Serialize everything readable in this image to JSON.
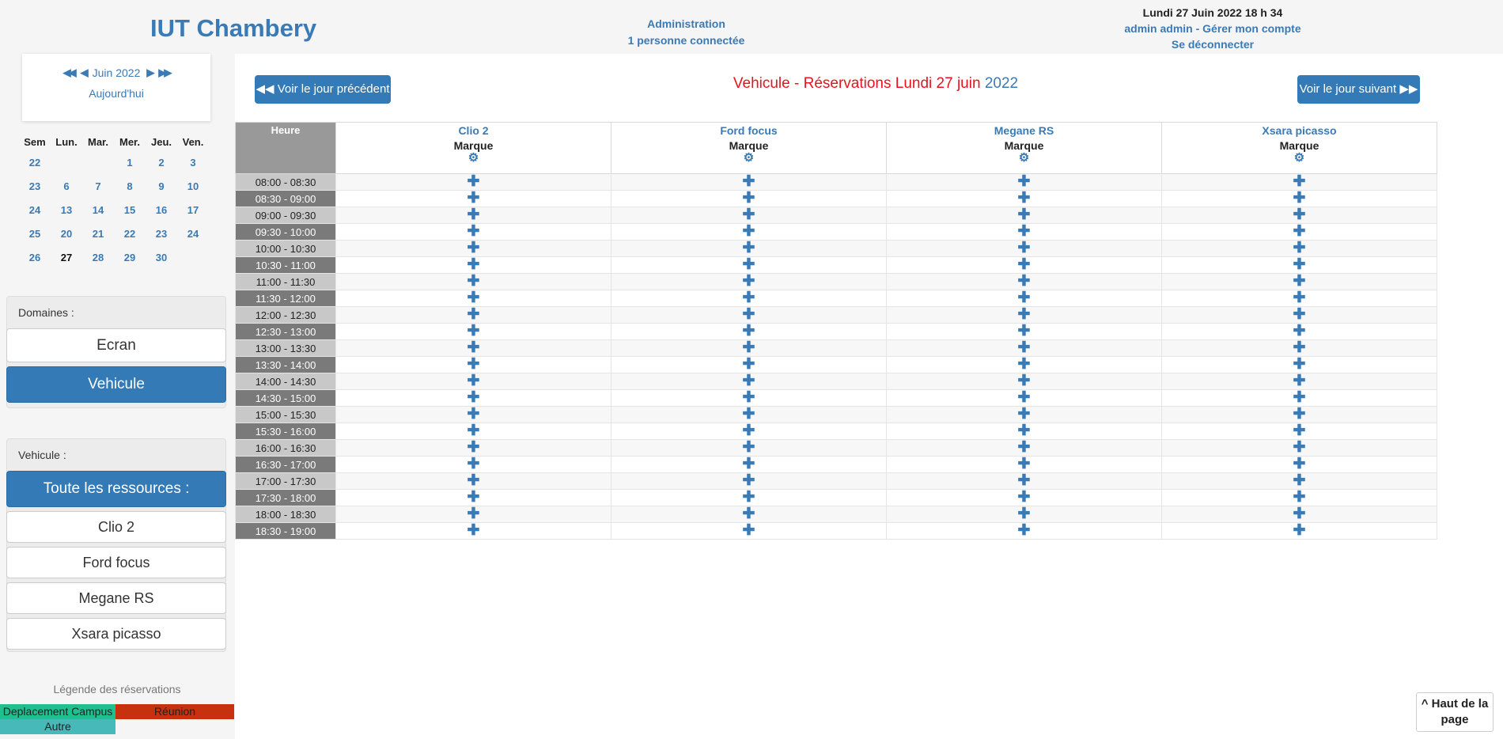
{
  "header": {
    "site_title": "IUT Chambery",
    "administration": "Administration",
    "connected": "1 personne connectée",
    "datetime": "Lundi 27 Juin 2022  18 h 34",
    "account": "admin admin - Gérer mon compte",
    "logout": "Se déconnecter"
  },
  "minical": {
    "month": "Juin 2022",
    "today": "Aujourd'hui",
    "headers": [
      "Sem",
      "Lun.",
      "Mar.",
      "Mer.",
      "Jeu.",
      "Ven."
    ],
    "weeks": [
      [
        "22",
        "",
        "",
        "1",
        "2",
        "3"
      ],
      [
        "23",
        "6",
        "7",
        "8",
        "9",
        "10"
      ],
      [
        "24",
        "13",
        "14",
        "15",
        "16",
        "17"
      ],
      [
        "25",
        "20",
        "21",
        "22",
        "23",
        "24"
      ],
      [
        "26",
        "27",
        "28",
        "29",
        "30",
        ""
      ]
    ],
    "current_day": "27"
  },
  "domains": {
    "title": "Domaines :",
    "items": [
      "Ecran",
      "Vehicule"
    ],
    "active": "Vehicule"
  },
  "resources": {
    "title": "Vehicule :",
    "all": "Toute les ressources :",
    "items": [
      "Clio 2",
      "Ford focus",
      "Megane RS",
      "Xsara picasso"
    ]
  },
  "legend": {
    "title": "Légende des réservations",
    "items": [
      {
        "label": "Deplacement Campus",
        "color": "#1fbf8f"
      },
      {
        "label": "Réunion",
        "color": "#c7310f"
      },
      {
        "label": "Autre",
        "color": "#48b9b9"
      }
    ]
  },
  "main": {
    "prev": "Voir le jour précédent",
    "next": "Voir le jour suivant",
    "title_domain": "Vehicule",
    "title_sep": " - ",
    "title_label": "Réservations",
    "title_date": "Lundi 27 juin",
    "title_year": "2022",
    "col_heure": "Heure",
    "columns": [
      {
        "name": "Clio 2",
        "sub": "Marque"
      },
      {
        "name": "Ford focus",
        "sub": "Marque"
      },
      {
        "name": "Megane RS",
        "sub": "Marque"
      },
      {
        "name": "Xsara picasso",
        "sub": "Marque"
      }
    ],
    "slots": [
      "08:00 - 08:30",
      "08:30 - 09:00",
      "09:00 - 09:30",
      "09:30 - 10:00",
      "10:00 - 10:30",
      "10:30 - 11:00",
      "11:00 - 11:30",
      "11:30 - 12:00",
      "12:00 - 12:30",
      "12:30 - 13:00",
      "13:00 - 13:30",
      "13:30 - 14:00",
      "14:00 - 14:30",
      "14:30 - 15:00",
      "15:00 - 15:30",
      "15:30 - 16:00",
      "16:00 - 16:30",
      "16:30 - 17:00",
      "17:00 - 17:30",
      "17:30 - 18:00",
      "18:00 - 18:30",
      "18:30 - 19:00"
    ],
    "add_symbol": "✚"
  },
  "back_to_top": "^ Haut de la page"
}
